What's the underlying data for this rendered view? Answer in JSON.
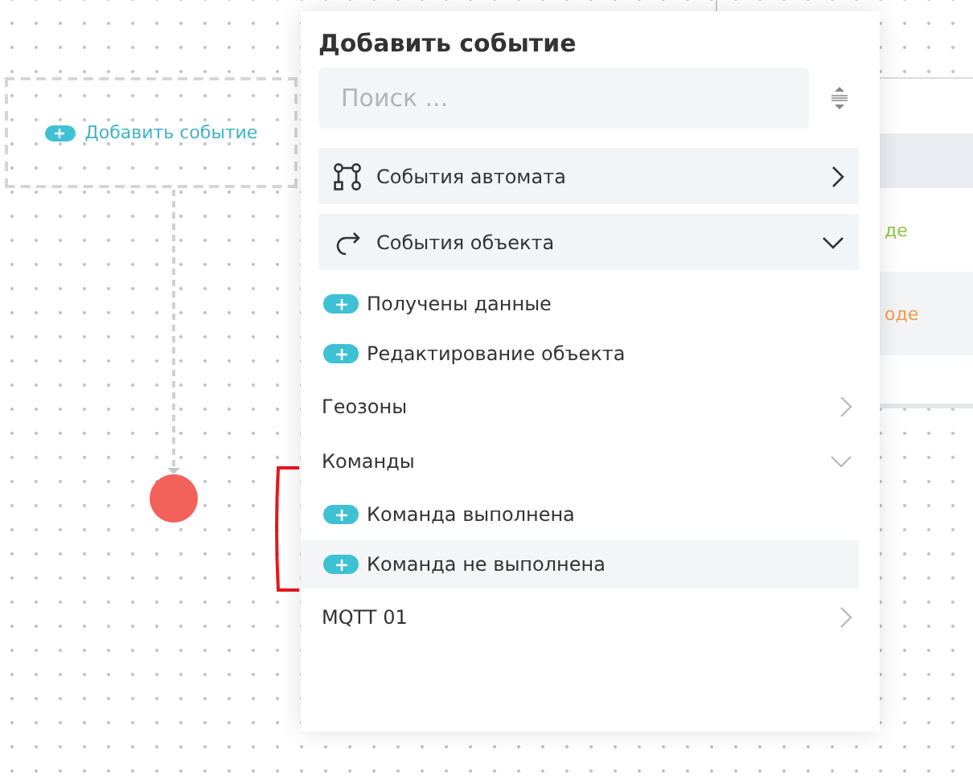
{
  "canvas": {
    "node_label": "Добавить событие",
    "side_texts": [
      {
        "text": "де",
        "color": "#8cc63f"
      },
      {
        "text": "оде",
        "color": "#f39c4a"
      }
    ]
  },
  "popup": {
    "title": "Добавить событие",
    "search": {
      "placeholder": "Поиск ..."
    },
    "items": [
      {
        "kind": "group",
        "label": "События автомата",
        "expanded": false
      },
      {
        "kind": "group",
        "label": "События объекта",
        "expanded": true
      },
      {
        "kind": "add",
        "label": "Получены данные",
        "selected": false
      },
      {
        "kind": "add",
        "label": "Редактирование объекта",
        "selected": false
      },
      {
        "kind": "section",
        "label": "Геозоны",
        "expanded": false
      },
      {
        "kind": "section",
        "label": "Команды",
        "expanded": true
      },
      {
        "kind": "add",
        "label": "Команда выполнена",
        "selected": false
      },
      {
        "kind": "add",
        "label": "Команда не выполнена",
        "selected": true
      },
      {
        "kind": "section",
        "label": "MQTT 01",
        "expanded": false
      }
    ]
  }
}
